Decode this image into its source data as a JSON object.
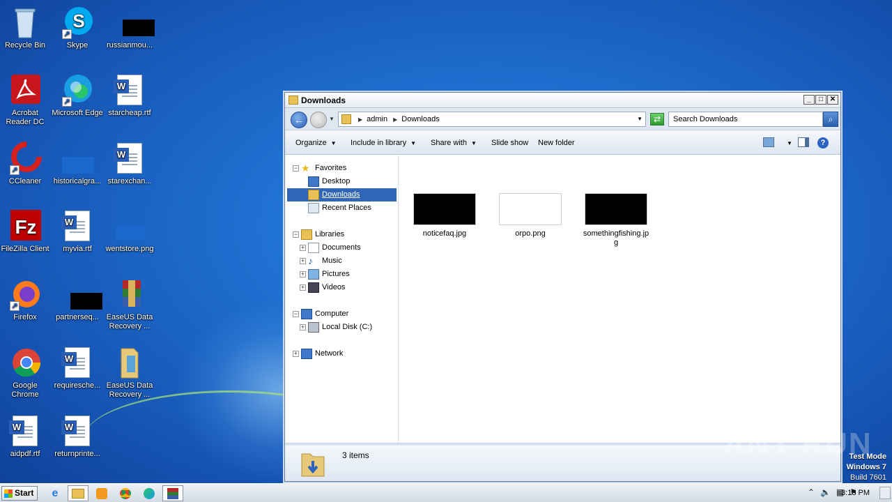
{
  "desktop": {
    "icons": [
      {
        "label": "Recycle Bin",
        "icon": "recycle-bin-icon"
      },
      {
        "label": "Skype",
        "icon": "skype-icon"
      },
      {
        "label": "russianmou...",
        "icon": "image-file-icon"
      },
      {
        "label": "Acrobat Reader DC",
        "icon": "acrobat-icon"
      },
      {
        "label": "Microsoft Edge",
        "icon": "edge-icon"
      },
      {
        "label": "starcheap.rtf",
        "icon": "word-doc-icon"
      },
      {
        "label": "CCleaner",
        "icon": "ccleaner-icon"
      },
      {
        "label": "historicalgra...",
        "icon": "image-file-icon"
      },
      {
        "label": "starexchan...",
        "icon": "word-doc-icon"
      },
      {
        "label": "FileZilla Client",
        "icon": "filezilla-icon"
      },
      {
        "label": "myvia.rtf",
        "icon": "word-doc-icon"
      },
      {
        "label": "wentstore.png",
        "icon": "image-file-icon"
      },
      {
        "label": "Firefox",
        "icon": "firefox-icon"
      },
      {
        "label": "partnerseq...",
        "icon": "image-file-icon"
      },
      {
        "label": "EaseUS Data Recovery ...",
        "icon": "winrar-icon"
      },
      {
        "label": "Google Chrome",
        "icon": "chrome-icon"
      },
      {
        "label": "requiresche...",
        "icon": "word-doc-icon"
      },
      {
        "label": "EaseUS Data Recovery ...",
        "icon": "folder-icon"
      },
      {
        "label": "aidpdf.rtf",
        "icon": "word-doc-icon"
      },
      {
        "label": "returnprinte...",
        "icon": "word-doc-icon"
      }
    ]
  },
  "window": {
    "title": "Downloads",
    "address": {
      "crumbs": [
        "admin",
        "Downloads"
      ]
    },
    "search": {
      "placeholder": "Search Downloads"
    },
    "toolbar": {
      "organize": "Organize",
      "include": "Include in library",
      "share": "Share with",
      "slideshow": "Slide show",
      "newfolder": "New folder"
    },
    "nav": {
      "favorites": "Favorites",
      "desktop": "Desktop",
      "downloads": "Downloads",
      "recent": "Recent Places",
      "libraries": "Libraries",
      "documents": "Documents",
      "music": "Music",
      "pictures": "Pictures",
      "videos": "Videos",
      "computer": "Computer",
      "localdisk": "Local Disk (C:)",
      "network": "Network"
    },
    "files": [
      {
        "name": "noticefaq.jpg",
        "thumb": "#000000"
      },
      {
        "name": "orpo.png",
        "thumb": "#ffffff"
      },
      {
        "name": "somethingfishing.jpg",
        "thumb": "#000000"
      }
    ],
    "status": {
      "count": "3 items"
    }
  },
  "taskbar": {
    "start": "Start",
    "clock": "3:18 PM"
  },
  "watermark": {
    "line1": "Test Mode",
    "line2": "Windows 7",
    "line3": "Build 7601",
    "brand": "ANY RUN"
  }
}
